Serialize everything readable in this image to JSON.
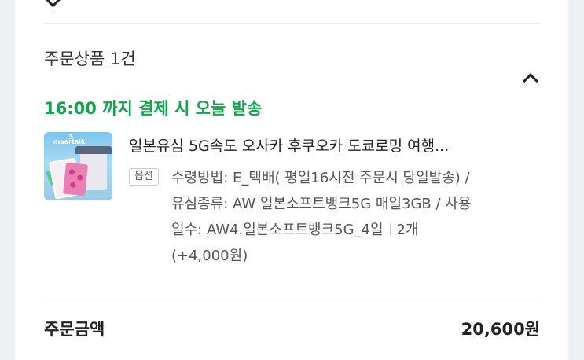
{
  "order_items": {
    "section_title": "주문상품 1건",
    "shipping_note": "16:00 까지 결제 시 오늘 발송",
    "product": {
      "title": "일본유심 5G속도 오사카 후쿠오카 도쿄로밍 여행...",
      "option_badge": "옵션",
      "option_line_1": "수령방법: E_택배( 평일16시전 주문시 당일발송) /",
      "option_line_2": "유심종류: AW 일본소프트뱅크5G 매일3GB / 사용",
      "option_line_3": "일수: AW4.일본소프트뱅크5G_4일",
      "quantity": "2개",
      "extra_price": "(+4,000원)",
      "thumbnail_logo": "maartalk"
    }
  },
  "summary": {
    "total_label": "주문금액",
    "total_amount": "20,600원"
  },
  "icons": {
    "collapse": "chevron-up-icon"
  },
  "colors": {
    "shipping_note": "#14a44d"
  }
}
